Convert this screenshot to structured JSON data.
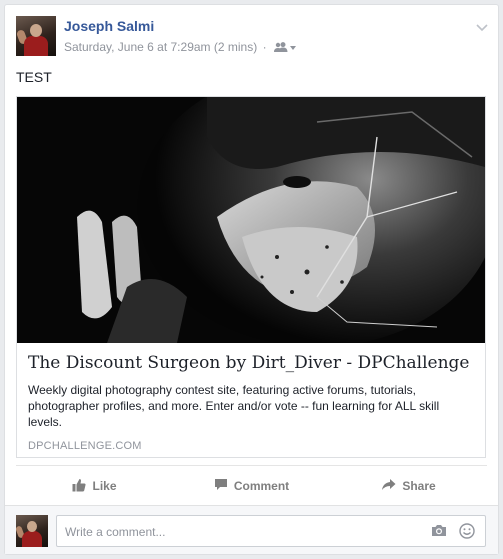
{
  "post": {
    "author": "Joseph Salmi",
    "timestamp": "Saturday, June 6 at 7:29am (2 mins)",
    "separator": "·",
    "audience_icon": "friends-icon",
    "text": "TEST"
  },
  "link_preview": {
    "title": "The Discount Surgeon by Dirt_Diver - DPChallenge",
    "description": "Weekly digital photography contest site, featuring active forums, tutorials, photographer profiles, and more. Enter and/or vote -- fun learning for ALL skill levels.",
    "domain": "DPCHALLENGE.COM"
  },
  "actions": {
    "like": "Like",
    "comment": "Comment",
    "share": "Share"
  },
  "comment_composer": {
    "placeholder": "Write a comment..."
  },
  "colors": {
    "author_link": "#365899",
    "muted": "#90949c",
    "action_text": "#7f7f7f"
  }
}
